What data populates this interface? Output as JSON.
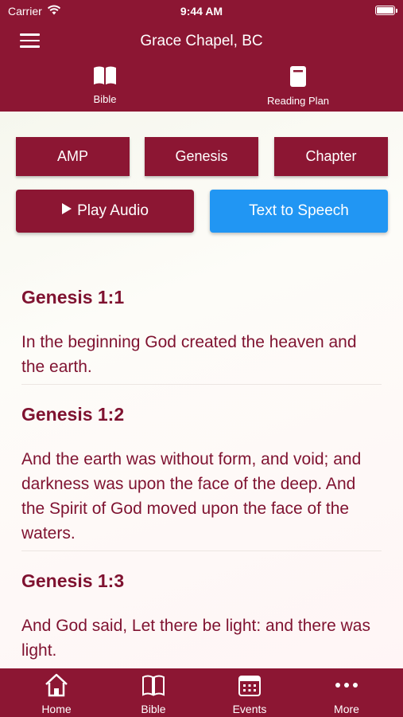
{
  "status_bar": {
    "carrier": "Carrier",
    "time": "9:44 AM"
  },
  "navbar": {
    "title": "Grace Chapel, BC"
  },
  "top_tabs": [
    {
      "label": "Bible",
      "icon": "open-book-icon"
    },
    {
      "label": "Reading Plan",
      "icon": "reading-plan-icon"
    }
  ],
  "selectors": {
    "version": "AMP",
    "book": "Genesis",
    "chapter": "Chapter"
  },
  "actions": {
    "play_audio": "Play Audio",
    "text_to_speech": "Text to Speech"
  },
  "verses": [
    {
      "reference": "Genesis 1:1",
      "text": "In the beginning God created the heaven and the earth."
    },
    {
      "reference": "Genesis 1:2",
      "text": "And the earth was without form, and void; and darkness was upon the face of the deep. And the Spirit of God moved upon the face of the waters."
    },
    {
      "reference": "Genesis 1:3",
      "text": "And God said, Let there be light: and there was light."
    }
  ],
  "bottom_tabs": [
    {
      "label": "Home",
      "icon": "home-icon"
    },
    {
      "label": "Bible",
      "icon": "open-book-icon"
    },
    {
      "label": "Events",
      "icon": "calendar-icon"
    },
    {
      "label": "More",
      "icon": "more-dots-icon"
    }
  ],
  "colors": {
    "brand": "#8c1633",
    "accent_blue": "#2196f3",
    "verse_text": "#7f1230"
  }
}
